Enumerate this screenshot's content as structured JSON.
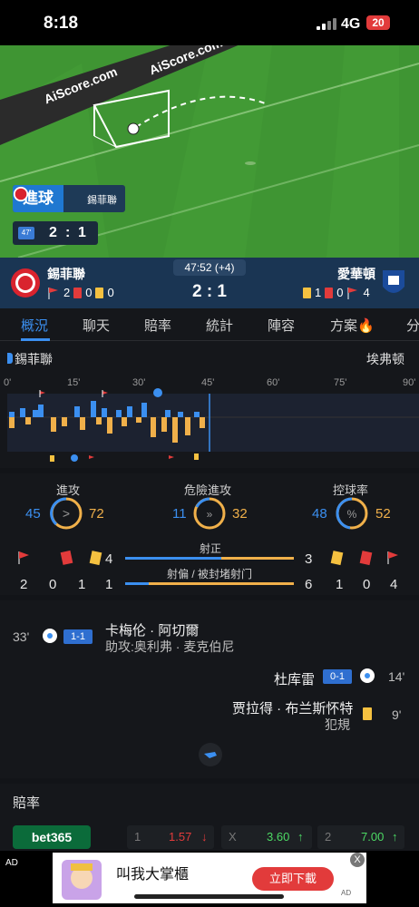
{
  "status_bar": {
    "time": "8:18",
    "network": "4G",
    "battery": "20"
  },
  "pitch": {
    "watermark": "AiScore.com",
    "event_label": "進球",
    "event_team": "錫菲聯",
    "minute_chip": "47'",
    "live_home": "2",
    "live_sep": ":",
    "live_away": "1"
  },
  "header": {
    "home_name": "錫菲聯",
    "away_name": "愛華頓",
    "clock": "47:52 (+4)",
    "score": "2 : 1",
    "home_corners": "2",
    "home_red": "0",
    "home_yellow": "0",
    "away_yellow": "1",
    "away_red": "0",
    "away_corners": "4"
  },
  "tabs": [
    "概況",
    "聊天",
    "賠率",
    "統計",
    "陣容",
    "方案",
    "分"
  ],
  "timeline": {
    "home_label": "錫菲聯",
    "away_label": "埃弗顿",
    "ticks": [
      "0'",
      "15'",
      "30'",
      "45'",
      "60'",
      "75'",
      "90'"
    ]
  },
  "stats": {
    "attack": {
      "title": "進攻",
      "home": "45",
      "away": "72"
    },
    "danger": {
      "title": "危險進攻",
      "home": "11",
      "away": "32"
    },
    "possession": {
      "title": "控球率",
      "home": "48",
      "away": "52",
      "home_fraction": 0.48
    },
    "home_row": {
      "corners": "2",
      "red": "0",
      "yellow": "1"
    },
    "away_row": {
      "corners": "4",
      "red": "0",
      "yellow": "1"
    },
    "on_target": {
      "label": "射正",
      "home": "4",
      "away": "3"
    },
    "off_target": {
      "label": "射偏 / 被封堵射门",
      "home": "1",
      "away": "6"
    }
  },
  "events": [
    {
      "minute": "33'",
      "score": "1-1",
      "player": "卡梅伦 · 阿切爾",
      "sub": "助攻:奥利弗 · 麦克伯尼",
      "side": "home"
    },
    {
      "minute": "14'",
      "score": "0-1",
      "player": "杜库雷",
      "sub": "",
      "side": "away"
    },
    {
      "minute": "9'",
      "score": "",
      "player": "贾拉得 · 布兰斯怀特",
      "sub": "犯規",
      "side": "away"
    }
  ],
  "odds": {
    "title": "賠率",
    "bookie": "bet365",
    "home_idx": "1",
    "home_val": "1.57",
    "draw_idx": "X",
    "draw_val": "3.60",
    "away_idx": "2",
    "away_val": "7.00"
  },
  "ad": {
    "tag": "AD",
    "title": "叫我大掌櫃",
    "button": "立即下載",
    "close": "X",
    "corner": "AD"
  },
  "colors": {
    "accent": "#3b8ff0",
    "home": "#3b8ff0",
    "away": "#f0b04a",
    "red": "#e23b3b",
    "yellow": "#f5c140"
  }
}
